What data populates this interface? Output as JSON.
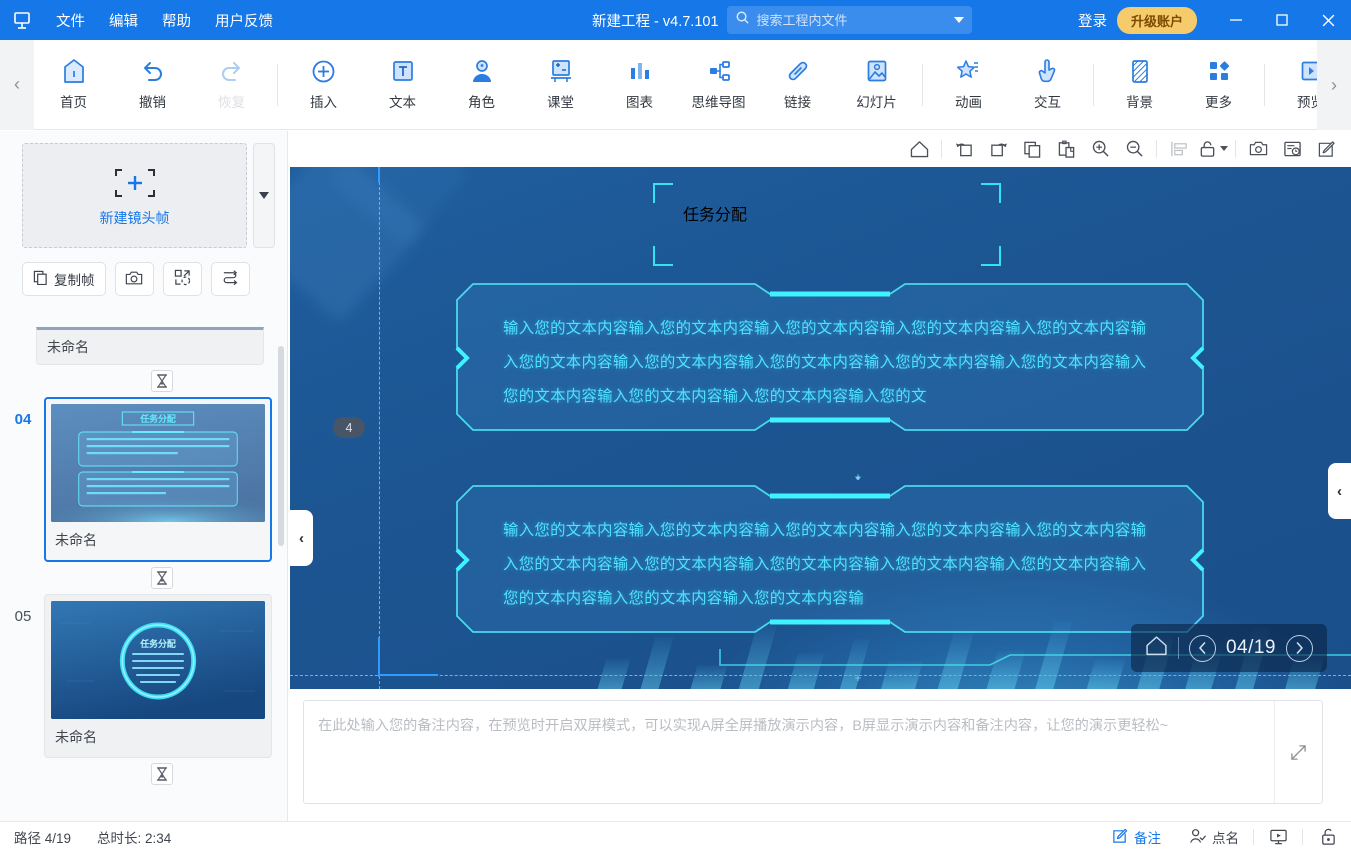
{
  "titlebar": {
    "logo_icon": "app-logo-icon",
    "menus": [
      "文件",
      "编辑",
      "帮助",
      "用户反馈"
    ],
    "project_title": "新建工程 - v4.7.101",
    "search_placeholder": "搜索工程内文件",
    "search_value": "",
    "search_icon": "search-icon",
    "dropdown_icon": "chevron-down-icon",
    "login_label": "登录",
    "upgrade_label": "升级账户",
    "minimize_icon": "minimize-icon",
    "maximize_icon": "maximize-icon",
    "close_icon": "close-icon",
    "bg_color": "#1677e8",
    "upgrade_color": "#f5cb6b"
  },
  "ribbon": {
    "scroll_left_icon": "chevron-left-icon",
    "scroll_right_icon": "chevron-right-icon",
    "groups": [
      {
        "items": [
          {
            "label": "首页",
            "icon": "home-icon",
            "disabled": false
          },
          {
            "label": "撤销",
            "icon": "undo-icon",
            "disabled": false
          },
          {
            "label": "恢复",
            "icon": "redo-icon",
            "disabled": true
          }
        ]
      },
      {
        "items": [
          {
            "label": "插入",
            "icon": "plus-circle-icon",
            "disabled": false
          },
          {
            "label": "文本",
            "icon": "text-box-icon",
            "disabled": false
          },
          {
            "label": "角色",
            "icon": "person-icon",
            "disabled": false
          },
          {
            "label": "课堂",
            "icon": "classroom-icon",
            "disabled": false
          },
          {
            "label": "图表",
            "icon": "bar-chart-icon",
            "disabled": false
          },
          {
            "label": "思维导图",
            "icon": "mindmap-icon",
            "disabled": false
          },
          {
            "label": "链接",
            "icon": "link-icon",
            "disabled": false
          },
          {
            "label": "幻灯片",
            "icon": "slide-image-icon",
            "disabled": false
          }
        ]
      },
      {
        "items": [
          {
            "label": "动画",
            "icon": "animation-star-icon",
            "disabled": false
          },
          {
            "label": "交互",
            "icon": "interaction-hand-icon",
            "disabled": false
          }
        ]
      },
      {
        "items": [
          {
            "label": "背景",
            "icon": "background-icon",
            "disabled": false
          },
          {
            "label": "更多",
            "icon": "more-grid-icon",
            "disabled": false
          }
        ]
      },
      {
        "items": [
          {
            "label": "预览",
            "icon": "preview-play-icon",
            "disabled": false
          }
        ]
      }
    ]
  },
  "leftpanel": {
    "new_frame_label": "新建镜头帧",
    "new_frame_icon": "add-frame-icon",
    "new_frame_dropdown_icon": "caret-down-icon",
    "tools": [
      {
        "label": "复制帧",
        "icon": "copy-frame-icon"
      },
      {
        "label": "",
        "icon": "camera-icon"
      },
      {
        "label": "",
        "icon": "fit-frame-icon"
      },
      {
        "label": "",
        "icon": "reorder-path-icon"
      }
    ],
    "partial_frame_name": "未命名",
    "connector_icon": "hourglass-icon",
    "frames": [
      {
        "number": "04",
        "name": "未命名",
        "active": true,
        "thumb": "task-assignment-two-panels"
      },
      {
        "number": "05",
        "name": "未命名",
        "active": false,
        "thumb": "task-assignment-ring"
      }
    ]
  },
  "canvasbar": {
    "items": [
      {
        "icon": "home-outline-icon",
        "disabled": false
      },
      {
        "icon": "rotate-left-icon",
        "disabled": false
      },
      {
        "icon": "rotate-right-icon",
        "disabled": false
      },
      {
        "icon": "copy-icon",
        "disabled": false
      },
      {
        "icon": "paste-icon",
        "disabled": false
      },
      {
        "icon": "zoom-in-icon",
        "disabled": false
      },
      {
        "icon": "zoom-out-icon",
        "disabled": false
      },
      {
        "icon": "align-left-icon",
        "disabled": true
      },
      {
        "icon": "unlock-icon",
        "disabled": false,
        "has_caret": true
      },
      {
        "icon": "snapshot-icon",
        "disabled": false
      },
      {
        "icon": "timeline-icon",
        "disabled": false
      },
      {
        "icon": "edit-icon",
        "disabled": false
      }
    ]
  },
  "slide": {
    "title": "任务分配",
    "frame_badge": "4",
    "panels": [
      {
        "text": "输入您的文本内容输入您的文本内容输入您的文本内容输入您的文本内容输入您的文本内容输入您的文本内容输入您的文本内容输入您的文本内容输入您的文本内容输入您的文本内容输入您的文本内容输入您的文本内容输入您的文本内容输入您的文"
      },
      {
        "text": "输入您的文本内容输入您的文本内容输入您的文本内容输入您的文本内容输入您的文本内容输入您的文本内容输入您的文本内容输入您的文本内容输入您的文本内容输入您的文本内容输入您的文本内容输入您的文本内容输入您的文本内容输"
      }
    ],
    "accent_color": "#3ce6fb",
    "background_color": "#1c5592",
    "page_nav": {
      "home_icon": "home-outline-icon",
      "prev_icon": "chevron-left-circle-icon",
      "next_icon": "chevron-right-circle-icon",
      "page_label": "04/19"
    },
    "collapse_left_icon": "chevron-left-icon",
    "collapse_right_icon": "chevron-left-icon"
  },
  "notes": {
    "placeholder": "在此处输入您的备注内容，在预览时开启双屏模式，可以实现A屏全屏播放演示内容，B屏显示演示内容和备注内容，让您的演示更轻松~",
    "value": "",
    "expand_icon": "expand-arrow-icon"
  },
  "statusbar": {
    "path_label": "路径 4/19",
    "duration_label": "总时长: 2:34",
    "notes_label": "备注",
    "notes_icon": "notes-edit-icon",
    "rollcall_label": "点名",
    "rollcall_icon": "person-check-icon",
    "present_icon": "monitor-play-icon",
    "lock_icon": "lock-icon",
    "active_color": "#1677e8"
  }
}
